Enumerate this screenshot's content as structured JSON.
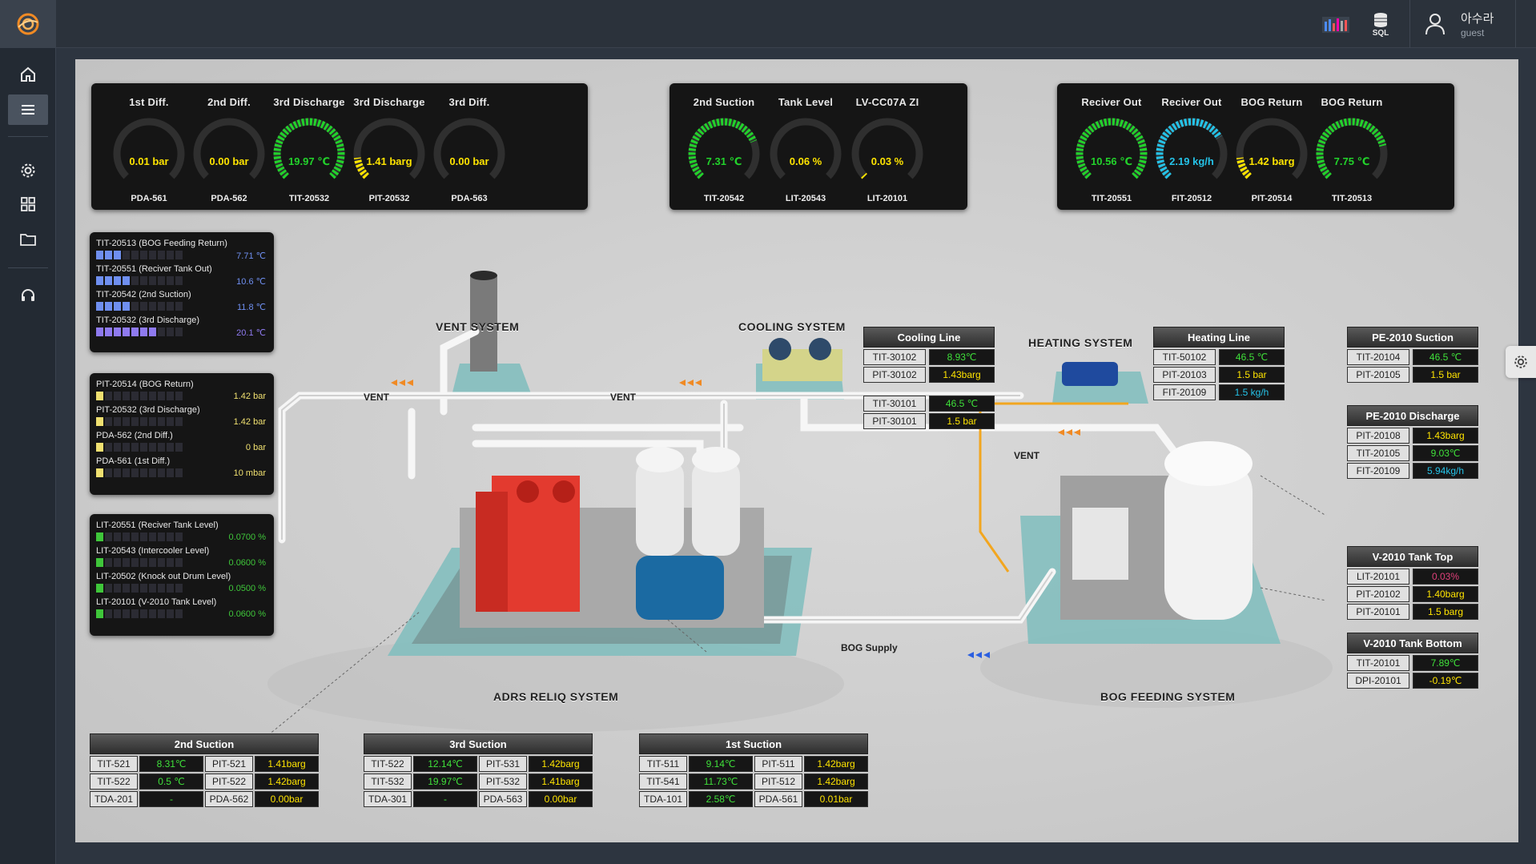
{
  "topbar": {
    "user_name": "아수라",
    "user_role": "guest",
    "sql_label": "SQL"
  },
  "sidebar": {
    "items": [
      {
        "name": "home-icon"
      },
      {
        "name": "menu-icon"
      },
      {
        "name": "gear-icon"
      },
      {
        "name": "grid-icon"
      },
      {
        "name": "folder-icon"
      },
      {
        "name": "headset-icon"
      }
    ]
  },
  "gauge_groups": [
    {
      "gauges": [
        {
          "title": "1st Diff.",
          "value": "0.01 bar",
          "tag": "PDA-561",
          "level": 0.0,
          "color": "#ffe400"
        },
        {
          "title": "2nd Diff.",
          "value": "0.00 bar",
          "tag": "PDA-562",
          "level": 0.0,
          "color": "#ffe400"
        },
        {
          "title": "3rd Discharge",
          "value": "19.97 ℃",
          "tag": "TIT-20532",
          "level": 1.0,
          "color": "#22d22b"
        },
        {
          "title": "3rd Discharge",
          "value": "1.41 barg",
          "tag": "PIT-20532",
          "level": 0.14,
          "color": "#ffe400"
        },
        {
          "title": "3rd Diff.",
          "value": "0.00 bar",
          "tag": "PDA-563",
          "level": 0.0,
          "color": "#ffe400"
        }
      ]
    },
    {
      "gauges": [
        {
          "title": "2nd Suction",
          "value": "7.31 ℃",
          "tag": "TIT-20542",
          "level": 0.75,
          "color": "#22d22b"
        },
        {
          "title": "Tank Level",
          "value": "0.06 %",
          "tag": "LIT-20543",
          "level": 0.0,
          "color": "#ffe400"
        },
        {
          "title": "LV-CC07A ZI",
          "value": "0.03 %",
          "tag": "LIT-20101",
          "level": 0.01,
          "color": "#ffe400"
        }
      ]
    },
    {
      "gauges": [
        {
          "title": "Reciver Out",
          "value": "10.56 ℃",
          "tag": "TIT-20551",
          "level": 1.0,
          "color": "#22d22b"
        },
        {
          "title": "Reciver Out",
          "value": "2.19 kg/h",
          "tag": "FIT-20512",
          "level": 0.72,
          "color": "#25c3e8"
        },
        {
          "title": "BOG Return",
          "value": "1.42 barg",
          "tag": "PIT-20514",
          "level": 0.14,
          "color": "#ffe400"
        },
        {
          "title": "BOG Return",
          "value": "7.75 ℃",
          "tag": "TIT-20513",
          "level": 0.78,
          "color": "#22d22b"
        }
      ]
    }
  ],
  "bar_panels": [
    {
      "items": [
        {
          "label": "TIT-20513 (BOG Feeding Return)",
          "value": "7.71 ℃",
          "level": 0.3,
          "color": "#6f8ff0"
        },
        {
          "label": "TIT-20551 (Reciver Tank Out)",
          "value": "10.6 ℃",
          "level": 0.4,
          "color": "#6f8ff0"
        },
        {
          "label": "TIT-20542 (2nd Suction)",
          "value": "11.8 ℃",
          "level": 0.4,
          "color": "#6f8ff0"
        },
        {
          "label": "TIT-20532 (3rd Discharge)",
          "value": "20.1 ℃",
          "level": 0.7,
          "color": "#8f7af0"
        }
      ]
    },
    {
      "items": [
        {
          "label": "PIT-20514 (BOG Return)",
          "value": "1.42 bar",
          "level": 0.1,
          "color": "#f0e070"
        },
        {
          "label": "PIT-20532 (3rd Discharge)",
          "value": "1.42 bar",
          "level": 0.1,
          "color": "#f0e070"
        },
        {
          "label": "PDA-562 (2nd Diff.)",
          "value": "0 bar",
          "level": 0.1,
          "color": "#f0e070"
        },
        {
          "label": "PDA-561 (1st Diff.)",
          "value": "10 mbar",
          "level": 0.1,
          "color": "#f0e070"
        }
      ]
    },
    {
      "items": [
        {
          "label": "LIT-20551 (Reciver Tank Level)",
          "value": "0.0700 %",
          "level": 0.1,
          "color": "#3fc63a"
        },
        {
          "label": "LIT-20543 (Intercooler Level)",
          "value": "0.0600 %",
          "level": 0.1,
          "color": "#3fc63a"
        },
        {
          "label": "LIT-20502 (Knock out Drum Level)",
          "value": "0.0500 %",
          "level": 0.1,
          "color": "#3fc63a"
        },
        {
          "label": "LIT-20101 (V-2010 Tank Level)",
          "value": "0.0600 %",
          "level": 0.1,
          "color": "#3fc63a"
        }
      ]
    }
  ],
  "system_labels": {
    "vent_system": "VENT SYSTEM",
    "cooling_system": "COOLING SYSTEM",
    "heating_system": "HEATING SYSTEM",
    "adrs_system": "ADRS RELIQ SYSTEM",
    "bog_feeding": "BOG FEEDING SYSTEM"
  },
  "flow_labels": {
    "vent_1": "VENT",
    "vent_2": "VENT",
    "vent_3": "VENT",
    "bog_supply": "BOG Supply"
  },
  "tables": {
    "cooling_line": {
      "title": "Cooling Line",
      "rows": [
        {
          "tag": "TIT-30102",
          "value": "8.93℃",
          "color": "#3fe03a"
        },
        {
          "tag": "PIT-30102",
          "value": "1.43barg",
          "color": "#ffe400"
        }
      ],
      "rows2": [
        {
          "tag": "TIT-30101",
          "value": "46.5 ℃",
          "color": "#3fe03a"
        },
        {
          "tag": "PIT-30101",
          "value": "1.5 bar",
          "color": "#ffe400"
        }
      ]
    },
    "heating_line": {
      "title": "Heating Line",
      "rows": [
        {
          "tag": "TIT-50102",
          "value": "46.5 ℃",
          "color": "#3fe03a"
        },
        {
          "tag": "PIT-20103",
          "value": "1.5 bar",
          "color": "#ffe400"
        },
        {
          "tag": "FIT-20109",
          "value": "1.5 kg/h",
          "color": "#25c3e8"
        }
      ]
    },
    "pe_suction": {
      "title": "PE-2010 Suction",
      "rows": [
        {
          "tag": "TIT-20104",
          "value": "46.5 ℃",
          "color": "#3fe03a"
        },
        {
          "tag": "PIT-20105",
          "value": "1.5 bar",
          "color": "#ffe400"
        }
      ]
    },
    "pe_discharge": {
      "title": "PE-2010 Discharge",
      "rows": [
        {
          "tag": "PIT-20108",
          "value": "1.43barg",
          "color": "#ffe400"
        },
        {
          "tag": "TIT-20105",
          "value": "9.03℃",
          "color": "#3fe03a"
        },
        {
          "tag": "FIT-20109",
          "value": "5.94kg/h",
          "color": "#25c3e8"
        }
      ]
    },
    "tank_top": {
      "title": "V-2010 Tank Top",
      "rows": [
        {
          "tag": "LIT-20101",
          "value": "0.03%",
          "color": "#e0407a"
        },
        {
          "tag": "PIT-20102",
          "value": "1.40barg",
          "color": "#ffe400"
        },
        {
          "tag": "PIT-20101",
          "value": "1.5 barg",
          "color": "#ffe400"
        }
      ]
    },
    "tank_bottom": {
      "title": "V-2010 Tank Bottom",
      "rows": [
        {
          "tag": "TIT-20101",
          "value": "7.89℃",
          "color": "#3fe03a"
        },
        {
          "tag": "DPI-20101",
          "value": "-0.19℃",
          "color": "#ffe400"
        }
      ]
    },
    "suction_2nd": {
      "title": "2nd Suction",
      "rows": [
        [
          {
            "tag": "TIT-521",
            "value": "8.31℃",
            "color": "#3fe03a"
          },
          {
            "tag": "PIT-521",
            "value": "1.41barg",
            "color": "#ffe400"
          }
        ],
        [
          {
            "tag": "TIT-522",
            "value": "0.5 ℃",
            "color": "#3fe03a"
          },
          {
            "tag": "PIT-522",
            "value": "1.42barg",
            "color": "#ffe400"
          }
        ],
        [
          {
            "tag": "TDA-201",
            "value": "-",
            "color": "#3fe03a"
          },
          {
            "tag": "PDA-562",
            "value": "0.00bar",
            "color": "#ffe400"
          }
        ]
      ]
    },
    "suction_3rd": {
      "title": "3rd Suction",
      "rows": [
        [
          {
            "tag": "TIT-522",
            "value": "12.14℃",
            "color": "#3fe03a"
          },
          {
            "tag": "PIT-531",
            "value": "1.42barg",
            "color": "#ffe400"
          }
        ],
        [
          {
            "tag": "TIT-532",
            "value": "19.97℃",
            "color": "#3fe03a"
          },
          {
            "tag": "PIT-532",
            "value": "1.41barg",
            "color": "#ffe400"
          }
        ],
        [
          {
            "tag": "TDA-301",
            "value": "-",
            "color": "#3fe03a"
          },
          {
            "tag": "PDA-563",
            "value": "0.00bar",
            "color": "#ffe400"
          }
        ]
      ]
    },
    "suction_1st": {
      "title": "1st Suction",
      "rows": [
        [
          {
            "tag": "TIT-511",
            "value": "9.14℃",
            "color": "#3fe03a"
          },
          {
            "tag": "PIT-511",
            "value": "1.42barg",
            "color": "#ffe400"
          }
        ],
        [
          {
            "tag": "TIT-541",
            "value": "11.73℃",
            "color": "#3fe03a"
          },
          {
            "tag": "PIT-512",
            "value": "1.42barg",
            "color": "#ffe400"
          }
        ],
        [
          {
            "tag": "TDA-101",
            "value": "2.58℃",
            "color": "#3fe03a"
          },
          {
            "tag": "PDA-561",
            "value": "0.01bar",
            "color": "#ffe400"
          }
        ]
      ]
    }
  }
}
